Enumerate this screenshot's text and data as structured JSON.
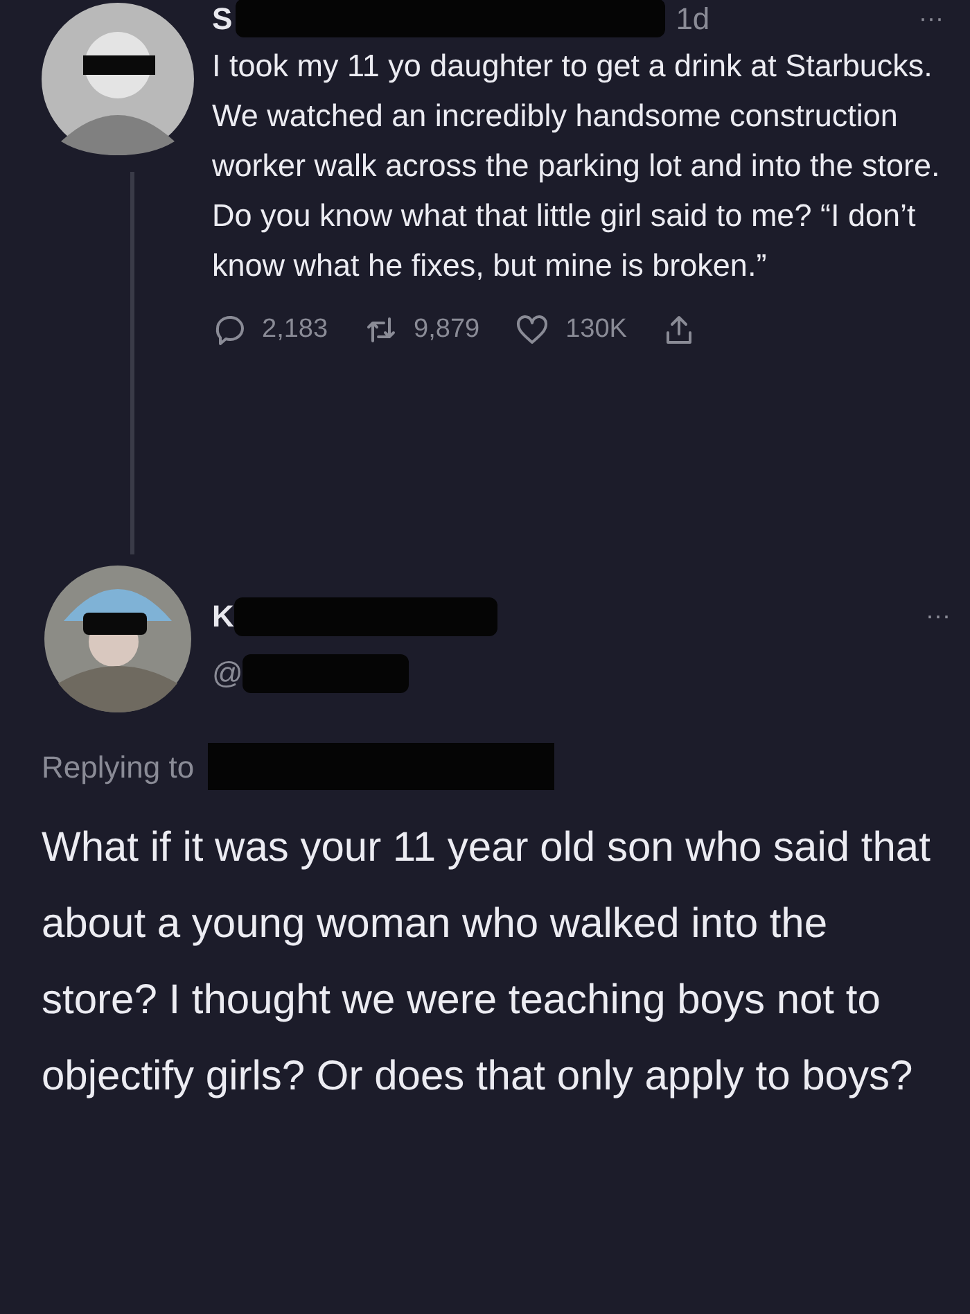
{
  "tweet": {
    "name": "S",
    "time": "1d",
    "more": "···",
    "text": "I took my 11 yo daughter to get a drink at Starbucks. We watched an incredibly handsome construction worker walk across the parking lot and into the store. Do you know what that little girl said to me? “I don’t know what he fixes, but mine is broken.”",
    "actions": [
      {
        "kind": "reply",
        "count": "2,183"
      },
      {
        "kind": "retweet",
        "count": "9,879"
      },
      {
        "kind": "like",
        "count": "130K"
      },
      {
        "kind": "share"
      }
    ]
  },
  "reply": {
    "name": "K",
    "handle": "@",
    "more": "···",
    "replying_to": "Replying to",
    "text": "What if it was your 11 year old son who said that about a young woman who walked into the store? I thought we were teaching boys not to objectify girls? Or does that only apply to boys?"
  }
}
